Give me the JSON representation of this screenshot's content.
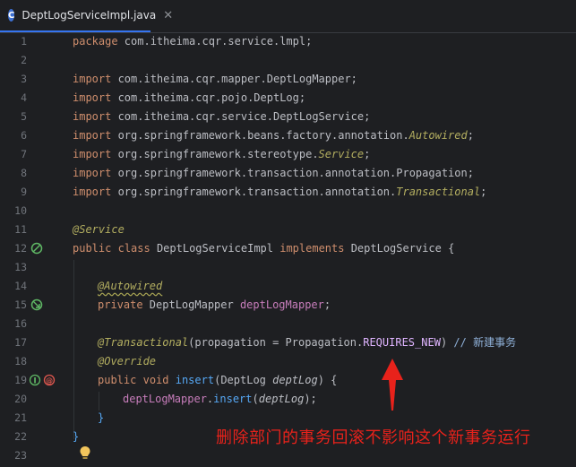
{
  "tab": {
    "icon_letter": "C",
    "title": "DeptLogServiceImpl.java",
    "close_glyph": "✕"
  },
  "lines": [
    {
      "n": "1"
    },
    {
      "n": "2"
    },
    {
      "n": "3"
    },
    {
      "n": "4"
    },
    {
      "n": "5"
    },
    {
      "n": "6"
    },
    {
      "n": "7"
    },
    {
      "n": "8"
    },
    {
      "n": "9"
    },
    {
      "n": "10"
    },
    {
      "n": "11"
    },
    {
      "n": "12"
    },
    {
      "n": "13"
    },
    {
      "n": "14"
    },
    {
      "n": "15"
    },
    {
      "n": "16"
    },
    {
      "n": "17"
    },
    {
      "n": "18"
    },
    {
      "n": "19"
    },
    {
      "n": "20"
    },
    {
      "n": "21"
    },
    {
      "n": "22"
    },
    {
      "n": "23"
    }
  ],
  "code": {
    "kw_package": "package",
    "pkg_name": " com.itheima.cqr.service.lmpl;",
    "kw_import": "import",
    "imp1": " com.itheima.cqr.mapper.DeptLogMapper;",
    "imp2": " com.itheima.cqr.pojo.DeptLog;",
    "imp3": " com.itheima.cqr.service.DeptLogService;",
    "imp4a": " org.springframework.beans.factory.annotation.",
    "imp4b": "Autowired",
    "imp5a": " org.springframework.stereotype.",
    "imp5b": "Service",
    "imp6": " org.springframework.transaction.annotation.Propagation;",
    "imp7a": " org.springframework.transaction.annotation.",
    "imp7b": "Transactional",
    "semi": ";",
    "ann_service": "@Service",
    "kw_public": "public",
    "kw_class": "class",
    "class_name": " DeptLogServiceImpl ",
    "kw_implements": "implements",
    "iface": " DeptLogService ",
    "brace_open": "{",
    "brace_close": "}",
    "ann_autowired": "@Autowired",
    "kw_private": "private",
    "field_type": " DeptLogMapper ",
    "field_name": "deptLogMapper",
    "ann_transactional": "@Transactional",
    "tx_args_a": "(propagation = Propagation.",
    "tx_const": "REQUIRES_NEW",
    "tx_args_b": ") ",
    "comment": "// 新建事务",
    "ann_override": "@Override",
    "kw_void": "void",
    "method_name": "insert",
    "param_type": "(DeptLog ",
    "param_name": "deptLog",
    "param_close": ") {",
    "call_obj": "deptLogMapper",
    "call_dot": ".",
    "call_method": "insert",
    "call_arg_open": "(",
    "call_arg": "deptLog",
    "call_end": ");"
  },
  "annotation_text": "删除部门的事务回滚不影响这个新事务运行",
  "colors": {
    "annotation_red": "#e8221b",
    "keyword": "#cf8e6d",
    "annotation": "#b3ae60",
    "background": "#1e1f22"
  }
}
